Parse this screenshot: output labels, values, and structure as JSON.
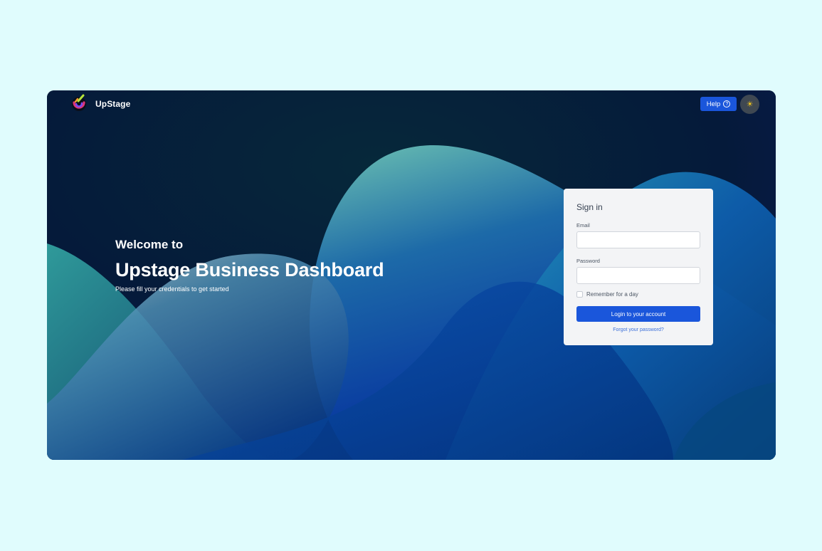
{
  "header": {
    "brand": "UpStage",
    "help_label": "Help",
    "help_icon": "question-circle-icon",
    "theme_icon": "sun-icon"
  },
  "hero": {
    "welcome": "Welcome to",
    "title": "Upstage Business Dashboard",
    "subtitle": "Please fill your credentials to get started"
  },
  "signin": {
    "heading": "Sign in",
    "email_label": "Email",
    "email_value": "",
    "password_label": "Password",
    "password_value": "",
    "remember_label": "Remember for a day",
    "remember_checked": false,
    "login_label": "Login to your account",
    "forgot_label": "Forgot your password?"
  },
  "colors": {
    "page_bg": "#e0fcfd",
    "primary": "#1a56db",
    "card_bg": "#f3f4f6",
    "hero_dark": "#061c36"
  }
}
